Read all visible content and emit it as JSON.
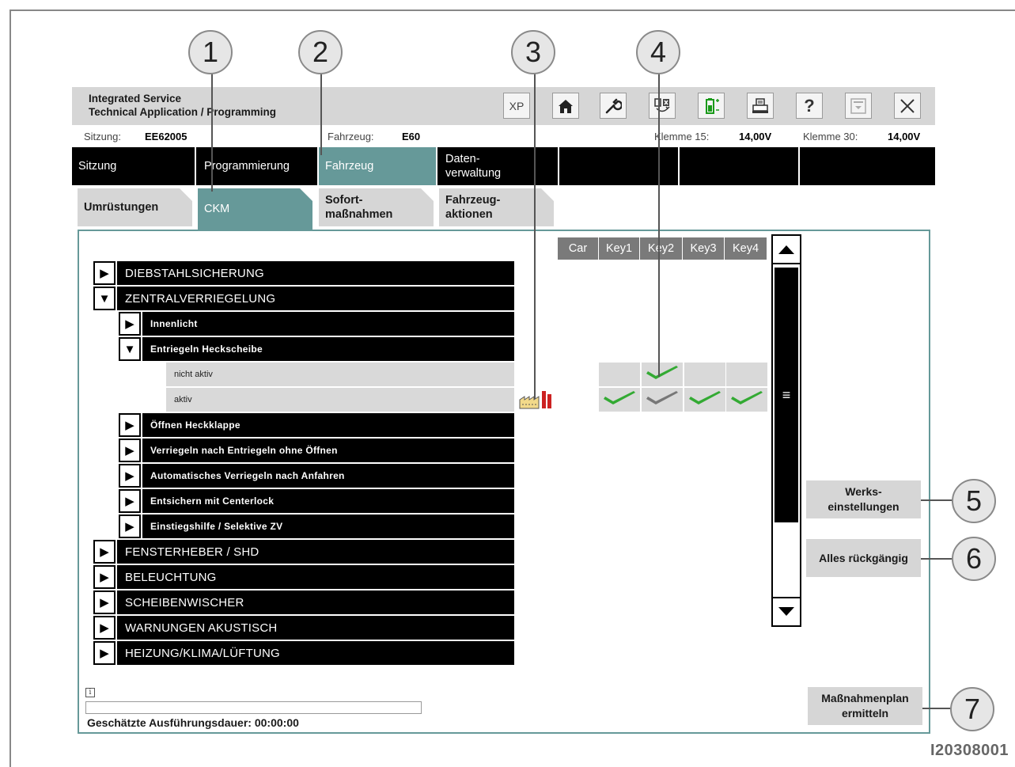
{
  "app": {
    "title_line1": "Integrated Service",
    "title_line2": "Technical Application / Programming"
  },
  "toolbar": {
    "xp_label": "XP"
  },
  "status": {
    "session_label": "Sitzung:",
    "session_value": "EE62005",
    "vehicle_label": "Fahrzeug:",
    "vehicle_value": "E60",
    "klemme15_label": "Klemme 15:",
    "klemme15_value": "14,00V",
    "klemme30_label": "Klemme 30:",
    "klemme30_value": "14,00V"
  },
  "nav": {
    "tabs": [
      "Sitzung",
      "Programmierung",
      "Fahrzeug",
      "Daten-\nverwaltung"
    ]
  },
  "subtabs": [
    "Umrüstungen",
    "CKM",
    "Sofort-\nmaßnahmen",
    "Fahrzeug-\naktionen"
  ],
  "columns": [
    "Car",
    "Key1",
    "Key2",
    "Key3",
    "Key4"
  ],
  "tree": [
    {
      "label": "DIEBSTAHLSICHERUNG",
      "level": 1,
      "expanded": false
    },
    {
      "label": "ZENTRALVERRIEGELUNG",
      "level": 1,
      "expanded": true
    },
    {
      "label": "Innenlicht",
      "level": 2,
      "expanded": false
    },
    {
      "label": "Entriegeln Heckscheibe",
      "level": 2,
      "expanded": true
    },
    {
      "label": "nicht aktiv",
      "level": 3,
      "option": true
    },
    {
      "label": "aktiv",
      "level": 3,
      "option": true
    },
    {
      "label": "Öffnen Heckklappe",
      "level": 2,
      "expanded": false
    },
    {
      "label": "Verriegeln nach Entriegeln ohne Öffnen",
      "level": 2,
      "expanded": false
    },
    {
      "label": "Automatisches Verriegeln nach Anfahren",
      "level": 2,
      "expanded": false
    },
    {
      "label": "Entsichern mit Centerlock",
      "level": 2,
      "expanded": false
    },
    {
      "label": "Einstiegshilfe / Selektive ZV",
      "level": 2,
      "expanded": false
    },
    {
      "label": "FENSTERHEBER / SHD",
      "level": 1,
      "expanded": false
    },
    {
      "label": "BELEUCHTUNG",
      "level": 1,
      "expanded": false
    },
    {
      "label": "SCHEIBENWISCHER",
      "level": 1,
      "expanded": false
    },
    {
      "label": "WARNUNGEN AKUSTISCH",
      "level": 1,
      "expanded": false
    },
    {
      "label": "HEIZUNG/KLIMA/LÜFTUNG",
      "level": 1,
      "expanded": false
    }
  ],
  "matrix": {
    "nicht_aktiv": [
      null,
      null,
      "green",
      null,
      null
    ],
    "aktiv": [
      null,
      "green",
      "grey",
      "green",
      "green"
    ]
  },
  "buttons": {
    "werks": "Werks-\neinstellungen",
    "undo": "Alles rückgängig",
    "plan": "Maßnahmenplan\nermitteln"
  },
  "progress": {
    "duration_label": "Geschätzte Ausführungsdauer: 00:00:00",
    "percent": 0
  },
  "callouts": [
    "1",
    "2",
    "3",
    "4",
    "5",
    "6",
    "7"
  ],
  "image_code": "I20308001",
  "colors": {
    "teal": "#669999",
    "check_green": "#33aa33",
    "check_grey": "#777777",
    "panel_grey": "#d6d6d6"
  }
}
